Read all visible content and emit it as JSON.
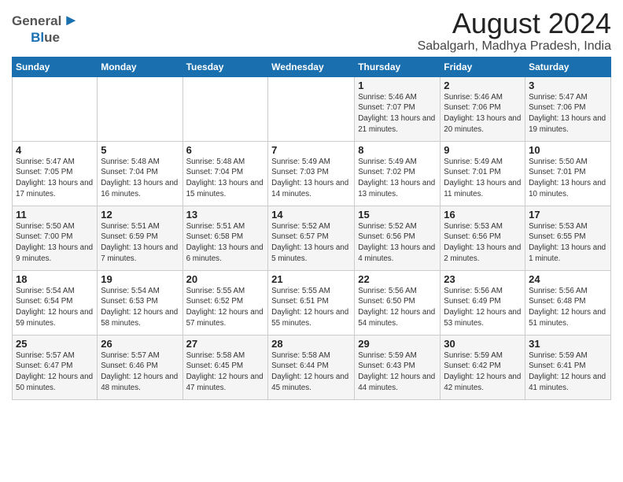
{
  "header": {
    "logo_general": "General",
    "logo_blue": "Blue",
    "month_title": "August 2024",
    "subtitle": "Sabalgarh, Madhya Pradesh, India"
  },
  "calendar": {
    "days_of_week": [
      "Sunday",
      "Monday",
      "Tuesday",
      "Wednesday",
      "Thursday",
      "Friday",
      "Saturday"
    ],
    "weeks": [
      [
        {
          "day": "",
          "info": ""
        },
        {
          "day": "",
          "info": ""
        },
        {
          "day": "",
          "info": ""
        },
        {
          "day": "",
          "info": ""
        },
        {
          "day": "1",
          "info": "Sunrise: 5:46 AM\nSunset: 7:07 PM\nDaylight: 13 hours\nand 21 minutes."
        },
        {
          "day": "2",
          "info": "Sunrise: 5:46 AM\nSunset: 7:06 PM\nDaylight: 13 hours\nand 20 minutes."
        },
        {
          "day": "3",
          "info": "Sunrise: 5:47 AM\nSunset: 7:06 PM\nDaylight: 13 hours\nand 19 minutes."
        }
      ],
      [
        {
          "day": "4",
          "info": "Sunrise: 5:47 AM\nSunset: 7:05 PM\nDaylight: 13 hours\nand 17 minutes."
        },
        {
          "day": "5",
          "info": "Sunrise: 5:48 AM\nSunset: 7:04 PM\nDaylight: 13 hours\nand 16 minutes."
        },
        {
          "day": "6",
          "info": "Sunrise: 5:48 AM\nSunset: 7:04 PM\nDaylight: 13 hours\nand 15 minutes."
        },
        {
          "day": "7",
          "info": "Sunrise: 5:49 AM\nSunset: 7:03 PM\nDaylight: 13 hours\nand 14 minutes."
        },
        {
          "day": "8",
          "info": "Sunrise: 5:49 AM\nSunset: 7:02 PM\nDaylight: 13 hours\nand 13 minutes."
        },
        {
          "day": "9",
          "info": "Sunrise: 5:49 AM\nSunset: 7:01 PM\nDaylight: 13 hours\nand 11 minutes."
        },
        {
          "day": "10",
          "info": "Sunrise: 5:50 AM\nSunset: 7:01 PM\nDaylight: 13 hours\nand 10 minutes."
        }
      ],
      [
        {
          "day": "11",
          "info": "Sunrise: 5:50 AM\nSunset: 7:00 PM\nDaylight: 13 hours\nand 9 minutes."
        },
        {
          "day": "12",
          "info": "Sunrise: 5:51 AM\nSunset: 6:59 PM\nDaylight: 13 hours\nand 7 minutes."
        },
        {
          "day": "13",
          "info": "Sunrise: 5:51 AM\nSunset: 6:58 PM\nDaylight: 13 hours\nand 6 minutes."
        },
        {
          "day": "14",
          "info": "Sunrise: 5:52 AM\nSunset: 6:57 PM\nDaylight: 13 hours\nand 5 minutes."
        },
        {
          "day": "15",
          "info": "Sunrise: 5:52 AM\nSunset: 6:56 PM\nDaylight: 13 hours\nand 4 minutes."
        },
        {
          "day": "16",
          "info": "Sunrise: 5:53 AM\nSunset: 6:56 PM\nDaylight: 13 hours\nand 2 minutes."
        },
        {
          "day": "17",
          "info": "Sunrise: 5:53 AM\nSunset: 6:55 PM\nDaylight: 13 hours\nand 1 minute."
        }
      ],
      [
        {
          "day": "18",
          "info": "Sunrise: 5:54 AM\nSunset: 6:54 PM\nDaylight: 12 hours\nand 59 minutes."
        },
        {
          "day": "19",
          "info": "Sunrise: 5:54 AM\nSunset: 6:53 PM\nDaylight: 12 hours\nand 58 minutes."
        },
        {
          "day": "20",
          "info": "Sunrise: 5:55 AM\nSunset: 6:52 PM\nDaylight: 12 hours\nand 57 minutes."
        },
        {
          "day": "21",
          "info": "Sunrise: 5:55 AM\nSunset: 6:51 PM\nDaylight: 12 hours\nand 55 minutes."
        },
        {
          "day": "22",
          "info": "Sunrise: 5:56 AM\nSunset: 6:50 PM\nDaylight: 12 hours\nand 54 minutes."
        },
        {
          "day": "23",
          "info": "Sunrise: 5:56 AM\nSunset: 6:49 PM\nDaylight: 12 hours\nand 53 minutes."
        },
        {
          "day": "24",
          "info": "Sunrise: 5:56 AM\nSunset: 6:48 PM\nDaylight: 12 hours\nand 51 minutes."
        }
      ],
      [
        {
          "day": "25",
          "info": "Sunrise: 5:57 AM\nSunset: 6:47 PM\nDaylight: 12 hours\nand 50 minutes."
        },
        {
          "day": "26",
          "info": "Sunrise: 5:57 AM\nSunset: 6:46 PM\nDaylight: 12 hours\nand 48 minutes."
        },
        {
          "day": "27",
          "info": "Sunrise: 5:58 AM\nSunset: 6:45 PM\nDaylight: 12 hours\nand 47 minutes."
        },
        {
          "day": "28",
          "info": "Sunrise: 5:58 AM\nSunset: 6:44 PM\nDaylight: 12 hours\nand 45 minutes."
        },
        {
          "day": "29",
          "info": "Sunrise: 5:59 AM\nSunset: 6:43 PM\nDaylight: 12 hours\nand 44 minutes."
        },
        {
          "day": "30",
          "info": "Sunrise: 5:59 AM\nSunset: 6:42 PM\nDaylight: 12 hours\nand 42 minutes."
        },
        {
          "day": "31",
          "info": "Sunrise: 5:59 AM\nSunset: 6:41 PM\nDaylight: 12 hours\nand 41 minutes."
        }
      ]
    ]
  }
}
